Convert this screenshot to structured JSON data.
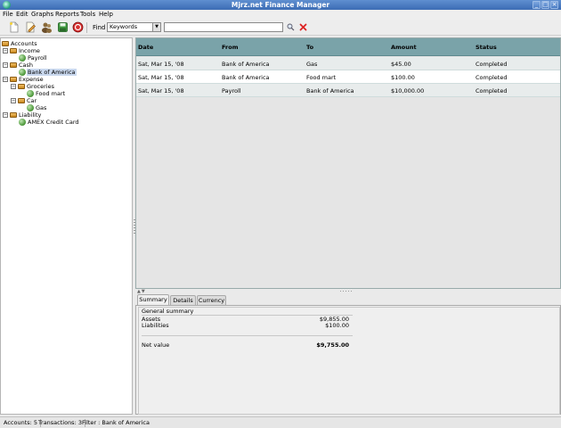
{
  "window": {
    "title": "Mjrz.net Finance Manager",
    "buttons": [
      "_",
      "□",
      "×"
    ]
  },
  "menu": [
    "File",
    "Edit",
    "Graphs",
    "Reports",
    "Tools",
    "Help"
  ],
  "toolbar": {
    "icons": [
      "new-file-icon",
      "edit-icon",
      "people-icon",
      "save-icon",
      "stop-icon"
    ],
    "find_label": "Find",
    "search_type": "Keywords",
    "search_value": "",
    "search_icon": "magnifier-icon",
    "clear_icon": "clear-x-icon",
    "clear_color": "#d22"
  },
  "tree": {
    "root": "Accounts",
    "items": [
      {
        "label": "Accounts"
      },
      {
        "label": "Income"
      },
      {
        "label": "Payroll"
      },
      {
        "label": "Cash"
      },
      {
        "label": "Bank of America"
      },
      {
        "label": "Expense"
      },
      {
        "label": "Groceries"
      },
      {
        "label": "Food mart"
      },
      {
        "label": "Car"
      },
      {
        "label": "Gas"
      },
      {
        "label": "Liability"
      },
      {
        "label": "AMEX Credit Card"
      }
    ]
  },
  "table": {
    "columns": [
      "Date",
      "From",
      "To",
      "Amount",
      "Status"
    ],
    "rows": [
      [
        "Sat, Mar 15, '08",
        "Bank of America",
        "Gas",
        "$45.00",
        "Completed"
      ],
      [
        "Sat, Mar 15, '08",
        "Bank of America",
        "Food mart",
        "$100.00",
        "Completed"
      ],
      [
        "Sat, Mar 15, '08",
        "Payroll",
        "Bank of America",
        "$10,000.00",
        "Completed"
      ]
    ],
    "header_color": "#7aa3a9"
  },
  "tabs": [
    "Summary",
    "Details",
    "Currency"
  ],
  "summary": {
    "title": "General summary",
    "assets_label": "Assets",
    "assets_value": "$9,855.00",
    "liabilities_label": "Liabilities",
    "liabilities_value": "$100.00",
    "net_label": "Net value",
    "net_value": "$9,755.00"
  },
  "status": {
    "accounts": "Accounts: 5",
    "transactions": "Transactions: 3",
    "filter": "Filter : Bank of America"
  }
}
